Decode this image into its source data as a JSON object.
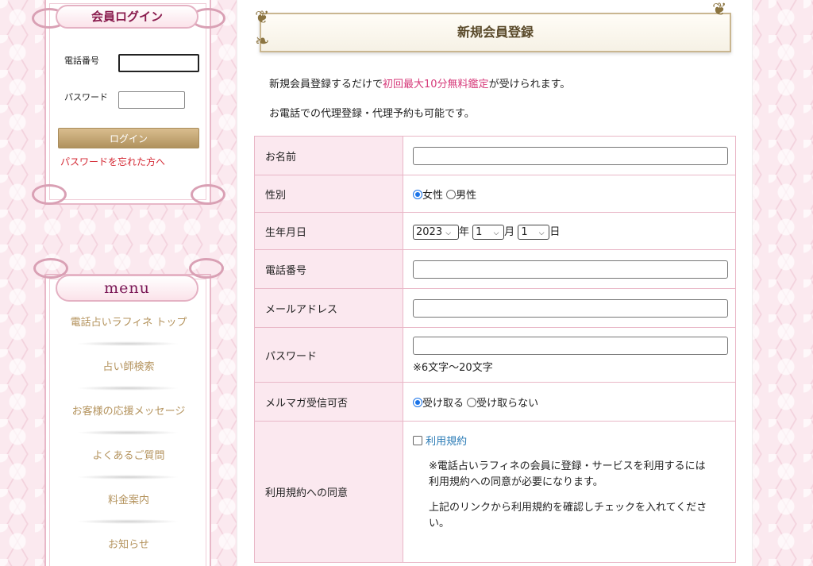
{
  "login": {
    "title": "会員ログイン",
    "phone_label": "電話番号",
    "password_label": "パスワード",
    "button": "ログイン",
    "forgot": "パスワードを忘れた方へ"
  },
  "menu": {
    "title": "menu",
    "items": [
      "電話占いラフィネ トップ",
      "占い師検索",
      "お客様の応援メッセージ",
      "よくあるご質問",
      "料金案内",
      "お知らせ"
    ]
  },
  "main": {
    "title": "新規会員登録",
    "intro1_pre": "新規会員登録するだけで",
    "intro1_hl": "初回最大10分無料鑑定",
    "intro1_post": "が受けられます。",
    "intro2": "お電話での代理登録・代理予約も可能です。"
  },
  "form": {
    "name_label": "お名前",
    "gender_label": "性別",
    "gender_female": "女性",
    "gender_male": "男性",
    "gender_selected": "女性",
    "birth_label": "生年月日",
    "birth_year": "2023",
    "birth_year_unit": "年",
    "birth_month": "1",
    "birth_month_unit": "月",
    "birth_day": "1",
    "birth_day_unit": "日",
    "phone_label": "電話番号",
    "email_label": "メールアドレス",
    "password_label": "パスワード",
    "password_note": "※6文字～20文字",
    "newsletter_label": "メルマガ受信可否",
    "newsletter_yes": "受け取る",
    "newsletter_no": "受け取らない",
    "newsletter_selected": "受け取る",
    "terms_label": "利用規約への同意",
    "terms_link": "利用規約",
    "terms_note1": "※電話占いラフィネの会員に登録・サービスを利用するには利用規約への同意が必要になります。",
    "terms_note2": "上記のリンクから利用規約を確認しチェックを入れてください。"
  },
  "colors": {
    "accent_pink": "#d63a7a",
    "link_blue": "#2a7bb6",
    "forgot_red": "#d42a35",
    "menu_gold": "#b4935d"
  }
}
